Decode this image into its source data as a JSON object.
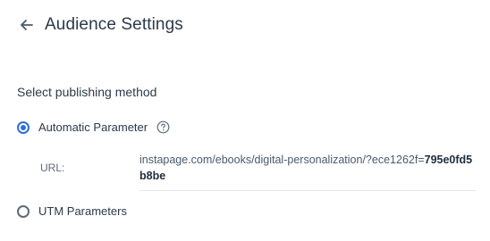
{
  "header": {
    "title": "Audience Settings",
    "back_icon": "arrow-left-icon"
  },
  "publishing": {
    "section_title": "Select publishing method",
    "options": [
      {
        "label": "Automatic Parameter",
        "selected": true,
        "help_icon": "question-circle-icon"
      },
      {
        "label": "UTM Parameters",
        "selected": false
      }
    ],
    "url": {
      "label": "URL:",
      "prefix": "instapage.com/ebooks/digital-personalization/?ece1262f=",
      "code": "795e0fd5b8be"
    }
  },
  "colors": {
    "accent": "#2e6fd8",
    "text": "#2b3a4a",
    "muted": "#5d6b78",
    "divider": "#e3e7eb"
  }
}
